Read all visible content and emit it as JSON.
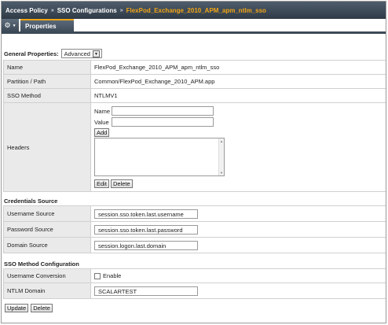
{
  "breadcrumb": {
    "item1": "Access Policy",
    "sep": "»",
    "item2": "SSO Configurations",
    "item3": "FlexPod_Exchange_2010_APM_apm_ntlm_sso"
  },
  "tabs": {
    "gear_icon": "gear-icon",
    "properties": "Properties"
  },
  "general": {
    "label": "General Properties:",
    "mode": "Advanced",
    "rows": {
      "name_label": "Name",
      "name_value": "FlexPod_Exchange_2010_APM_apm_ntlm_sso",
      "partition_label": "Partition / Path",
      "partition_value": "Common/FlexPod_Exchange_2010_APM.app",
      "method_label": "SSO Method",
      "method_value": "NTLMV1",
      "headers_label": "Headers",
      "hdr_name_label": "Name",
      "hdr_value_label": "Value",
      "hdr_name_value": "",
      "hdr_value_value": "",
      "add_button": "Add",
      "edit_button": "Edit",
      "delete_button": "Delete"
    }
  },
  "credentials": {
    "title": "Credentials Source",
    "username_label": "Username Source",
    "username_value": "session.sso.token.last.username",
    "password_label": "Password Source",
    "password_value": "session.sso.token.last.password",
    "domain_label": "Domain Source",
    "domain_value": "session.logon.last.domain"
  },
  "sso_method": {
    "title": "SSO Method Configuration",
    "conversion_label": "Username Conversion",
    "conversion_option": "Enable",
    "conversion_checked": false,
    "ntlm_domain_label": "NTLM Domain",
    "ntlm_domain_value": "SCALARTEST"
  },
  "footer": {
    "update_button": "Update",
    "delete_button": "Delete"
  },
  "colors": {
    "nav_dark": "#3d4a57",
    "accent": "#f2a515",
    "label_bg": "#eaeaea"
  }
}
